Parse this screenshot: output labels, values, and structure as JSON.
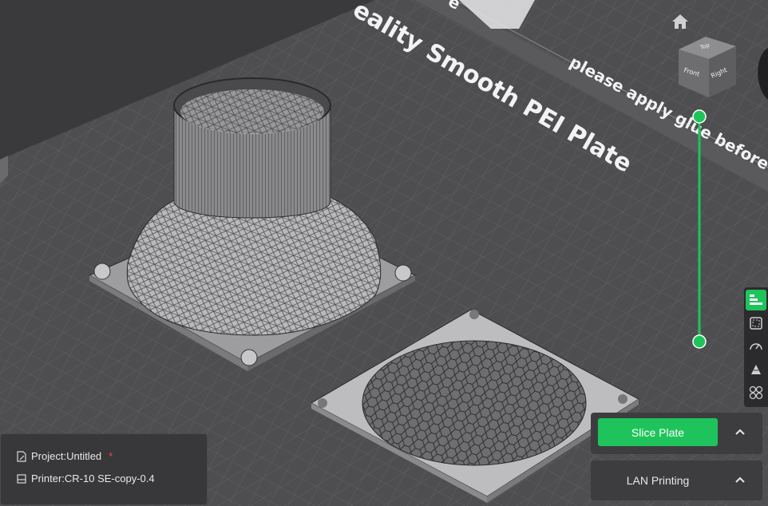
{
  "plate": {
    "name_text": "eality Smooth PEI Plate",
    "partial_text": "e",
    "notice_text": "please apply glue before"
  },
  "view_cube": {
    "top": "Top",
    "front": "Front",
    "right": "Right"
  },
  "layer_slider": {
    "accent": "#1ec45b"
  },
  "side_toolbar": {
    "items": [
      {
        "icon": "layers-icon",
        "active": true
      },
      {
        "icon": "select-frame-icon",
        "active": false
      },
      {
        "icon": "speed-gauge-icon",
        "active": false
      },
      {
        "icon": "support-paint-icon",
        "active": false
      },
      {
        "icon": "arrange-icon",
        "active": false
      }
    ]
  },
  "project": {
    "label": "Project:Untitled",
    "modified_mark": "*"
  },
  "printer": {
    "label": "Printer:CR-10 SE-copy-0.4"
  },
  "actions": {
    "slice_label": "Slice Plate",
    "lan_label": "LAN Printing"
  },
  "colors": {
    "accent": "#1ec45b",
    "bed": "#4e4e50",
    "grid": "#5d5d60",
    "modified": "#e84c4c"
  }
}
